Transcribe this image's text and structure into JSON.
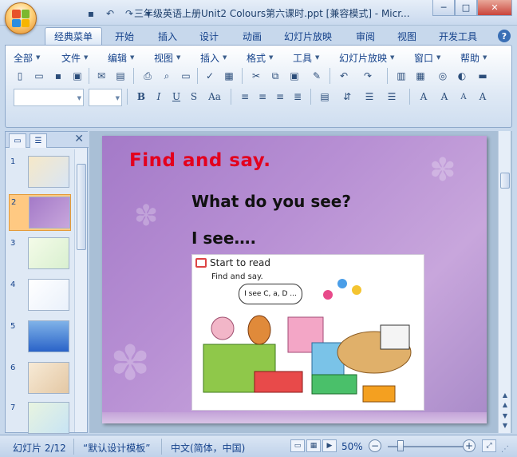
{
  "window": {
    "title": "三年级英语上册Unit2 Colours第六课时.ppt [兼容模式] - Micr...",
    "controls": {
      "minimize": "─",
      "maximize": "□",
      "close": "✕"
    }
  },
  "quick_access": [
    "save-icon",
    "undo-icon",
    "redo-icon",
    "customize-icon"
  ],
  "tabs": [
    {
      "label": "经典菜单",
      "active": true
    },
    {
      "label": "开始"
    },
    {
      "label": "插入"
    },
    {
      "label": "设计"
    },
    {
      "label": "动画"
    },
    {
      "label": "幻灯片放映"
    },
    {
      "label": "审阅"
    },
    {
      "label": "视图"
    },
    {
      "label": "开发工具"
    }
  ],
  "help": "?",
  "menus": [
    "全部",
    "文件",
    "编辑",
    "视图",
    "插入",
    "格式",
    "工具",
    "幻灯片放映",
    "窗口",
    "帮助"
  ],
  "slides_pane": {
    "count": 7,
    "numbers": [
      "1",
      "2",
      "3",
      "4",
      "5",
      "6",
      "7"
    ],
    "selected": 2
  },
  "slide": {
    "title": "Find and say.",
    "question": "What do you see?",
    "answer": "I see….",
    "picture": {
      "heading": "Start to read",
      "sub": "Find and say.",
      "bubble": "I see C, a, D ..."
    }
  },
  "status": {
    "slide_info": "幻灯片 2/12",
    "theme": "“默认设计模板”",
    "language": "中文(简体，中国)",
    "zoom": "50%",
    "zoom_minus": "−",
    "zoom_plus": "+"
  },
  "colors": {
    "title_red": "#e3001e",
    "slide_purple": "#b890d4",
    "ribbon_blue": "#c7d8ec"
  }
}
